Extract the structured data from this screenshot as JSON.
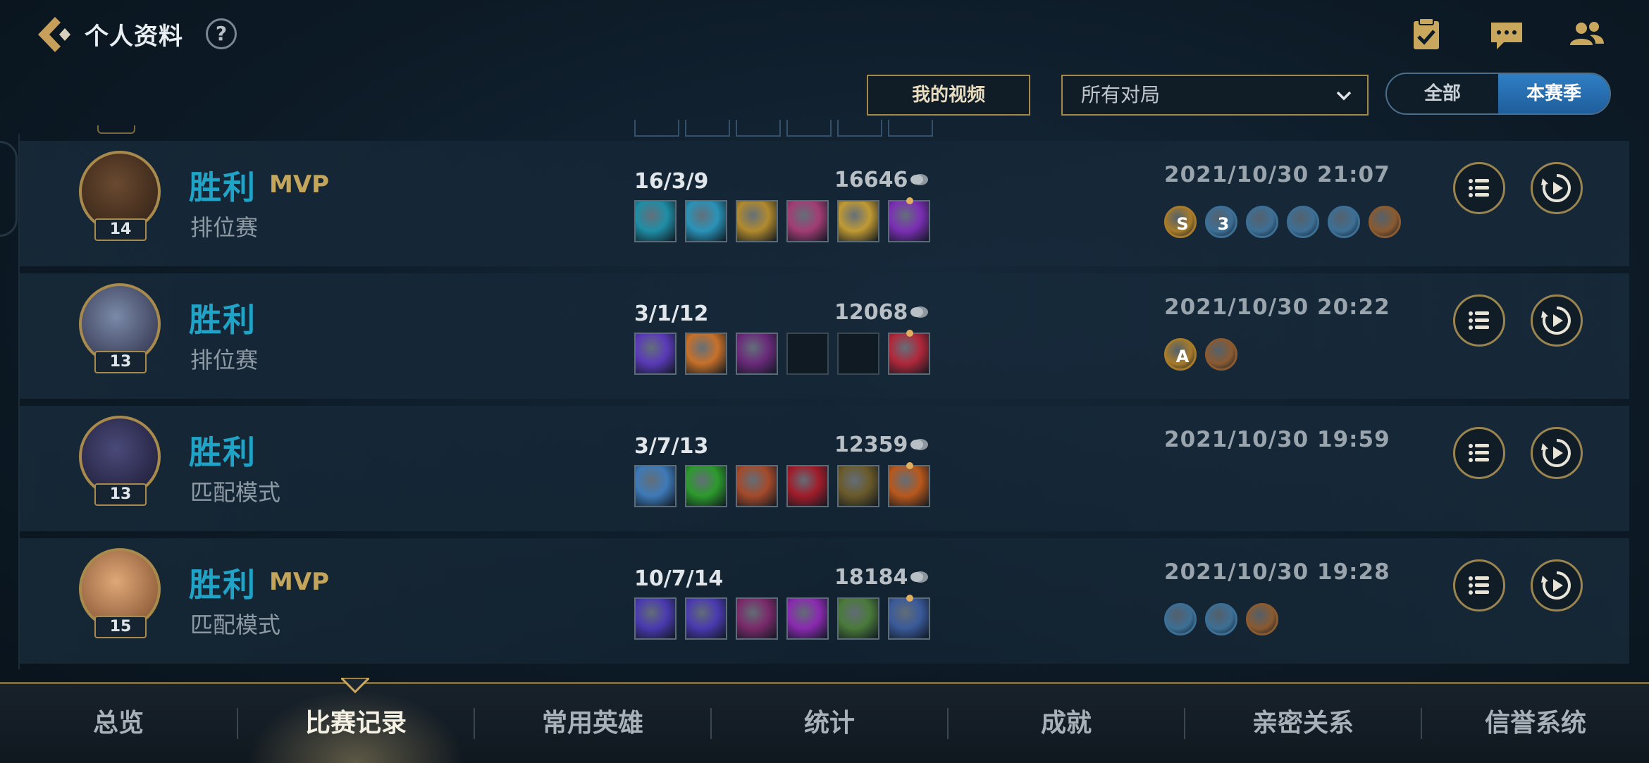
{
  "header": {
    "title": "个人资料",
    "help_label": "?",
    "icons": [
      "checklist-icon",
      "chat-icon",
      "friends-icon"
    ]
  },
  "filters": {
    "video_button": "我的视频",
    "match_filter": "所有对局",
    "season_toggle": {
      "options": [
        "全部",
        "本赛季"
      ],
      "selected": "本赛季"
    }
  },
  "matches": [
    {
      "result": "胜利",
      "mvp": "MVP",
      "mode": "排位赛",
      "level": "14",
      "kda": "16/3/9",
      "gold": "16646",
      "date": "2021/10/30 21:07",
      "items": [
        "#1f8ea6",
        "#2a93b8",
        "#b18a2e",
        "#a23d74",
        "#c09a34",
        "#7b2fb4"
      ],
      "badges": [
        {
          "label": "S",
          "color": "#a77b2a"
        },
        {
          "label": "3",
          "color": "#3d6f95"
        },
        {
          "label": "",
          "color": "#3d6f95"
        },
        {
          "label": "",
          "color": "#3d6f95"
        },
        {
          "label": "",
          "color": "#3d6f95"
        },
        {
          "label": "",
          "color": "#8a5a30"
        }
      ]
    },
    {
      "result": "胜利",
      "mvp": "",
      "mode": "排位赛",
      "level": "13",
      "kda": "3/1/12",
      "gold": "12068",
      "date": "2021/10/30 20:22",
      "items": [
        "#5a3ab8",
        "#c7712a",
        "#6a2a7a",
        "",
        "",
        "#b0283a"
      ],
      "badges": [
        {
          "label": "A",
          "color": "#a77b2a"
        },
        {
          "label": "",
          "color": "#8a5a30"
        }
      ]
    },
    {
      "result": "胜利",
      "mvp": "",
      "mode": "匹配模式",
      "level": "13",
      "kda": "3/7/13",
      "gold": "12359",
      "date": "2021/10/30 19:59",
      "items": [
        "#3e7ab8",
        "#2c9a2c",
        "#a44a2a",
        "#a01c2a",
        "#6a5a2a",
        "#b8581c"
      ],
      "badges": []
    },
    {
      "result": "胜利",
      "mvp": "MVP",
      "mode": "匹配模式",
      "level": "15",
      "kda": "10/7/14",
      "gold": "18184",
      "date": "2021/10/30 19:28",
      "items": [
        "#4a3ab0",
        "#4a3ab0",
        "#7a2a6a",
        "#8a2ab0",
        "#4a7a3a",
        "#3a5a9a"
      ],
      "badges": [
        {
          "label": "",
          "color": "#3d6f95"
        },
        {
          "label": "",
          "color": "#3d6f95"
        },
        {
          "label": "",
          "color": "#8a5a30"
        }
      ]
    }
  ],
  "bottom_nav": {
    "items": [
      "总览",
      "比赛记录",
      "常用英雄",
      "统计",
      "成就",
      "亲密关系",
      "信誉系统"
    ],
    "active": "比赛记录"
  },
  "colors": {
    "accent_gold": "#a6884a",
    "win_blue": "#1fa4c8",
    "mvp_gold": "#c4a55c",
    "toggle_active": "#2f7fc4"
  }
}
